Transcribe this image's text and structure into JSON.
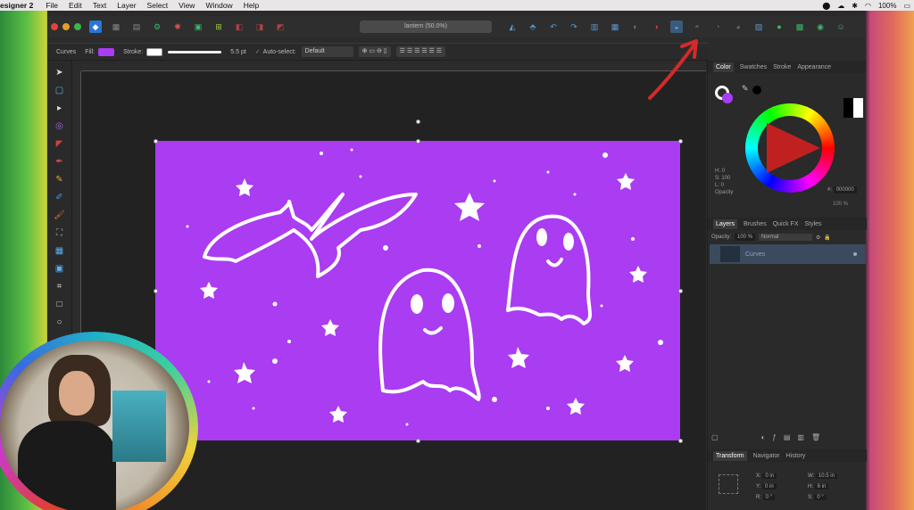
{
  "menubar": {
    "app": "esigner 2",
    "items": [
      "File",
      "Edit",
      "Text",
      "Layer",
      "Select",
      "View",
      "Window",
      "Help"
    ],
    "battery": "100%"
  },
  "toolbar": {
    "document_title": "lantern (50.0%)"
  },
  "context": {
    "tool_name": "Curves",
    "fill_label": "Fill:",
    "stroke_label": "Stroke:",
    "stroke_width": "5.5 pt",
    "autoselect_label": "Auto-select:",
    "autoselect_value": "Default"
  },
  "colors": {
    "artboard": "#aa3cf2",
    "fill_swatch": "#aa3cf2",
    "accent_arrow": "#d42a2a"
  },
  "panel": {
    "color_tabs": [
      "Color",
      "Swatches",
      "Stroke",
      "Appearance"
    ],
    "hsl": {
      "h": "H: 0",
      "s": "S: 100",
      "l": "L: 0"
    },
    "opacity_label": "Opacity",
    "hex_prefix": "#:",
    "hex_value": "000000",
    "opacity_value": "100 %",
    "layers_tabs": [
      "Layers",
      "Brushes",
      "Quick FX",
      "Styles"
    ],
    "layers_opacity_label": "Opacity:",
    "layers_opacity_value": "100 %",
    "blend_mode": "Normal",
    "layer_name": "Curves",
    "transform_tabs": [
      "Transform",
      "Navigator",
      "History"
    ],
    "transform": {
      "x_label": "X:",
      "x_value": "0 in",
      "y_label": "Y:",
      "y_value": "0 in",
      "w_label": "W:",
      "w_value": "10.5 in",
      "h_label": "H:",
      "h_value": "6 in",
      "r_label": "R:",
      "r_value": "0 °",
      "s_label": "S:",
      "s_value": "0 °"
    }
  }
}
